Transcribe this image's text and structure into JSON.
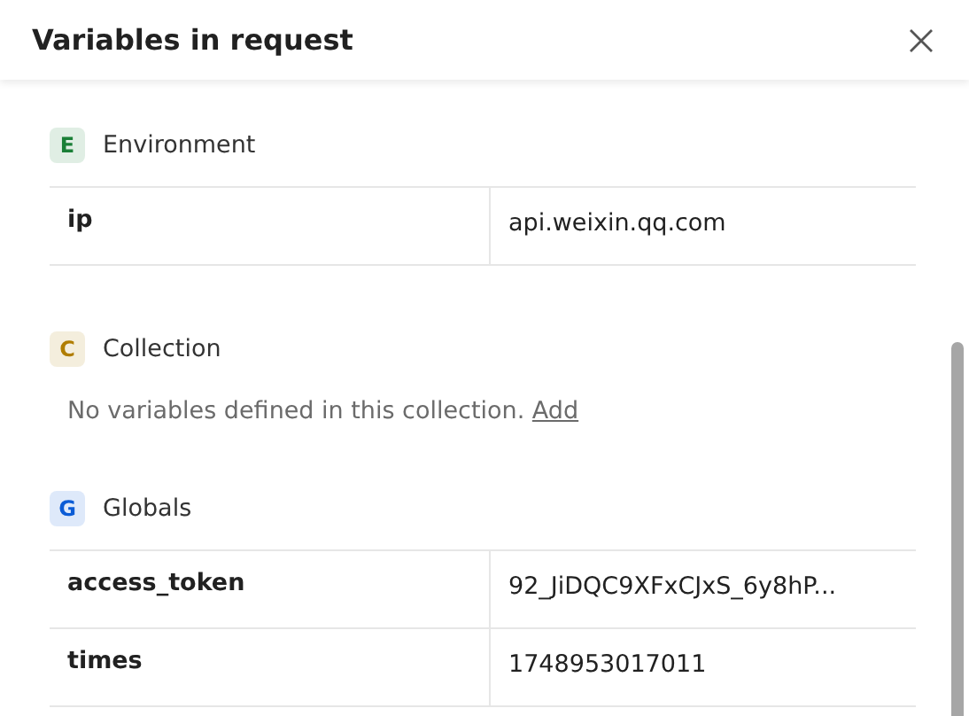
{
  "window": {
    "title": "Variables in request"
  },
  "sections": [
    {
      "badge": "E",
      "name": "Environment",
      "color": "#1a7f37",
      "variables": [
        {
          "name": "ip",
          "value": "api.weixin.qq.com"
        }
      ]
    },
    {
      "badge": "C",
      "name": "Collection",
      "color": "#b07d00",
      "empty_text": "No variables defined in this collection.",
      "empty_link": "Add"
    },
    {
      "badge": "G",
      "name": "Globals",
      "color": "#0b5cd6",
      "variables": [
        {
          "name": "access_token",
          "value": "92_JiDQC9XFxCJxS_6y8hP..."
        },
        {
          "name": "times",
          "value": "1748953017011"
        }
      ]
    }
  ]
}
